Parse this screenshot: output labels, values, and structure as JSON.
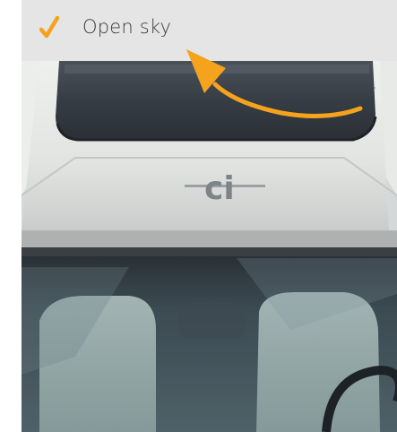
{
  "option": {
    "label": "Open sky",
    "checked": true,
    "check_icon": "check-icon",
    "accent_color": "#f5a21d"
  },
  "photo": {
    "logo_text": "ci"
  }
}
